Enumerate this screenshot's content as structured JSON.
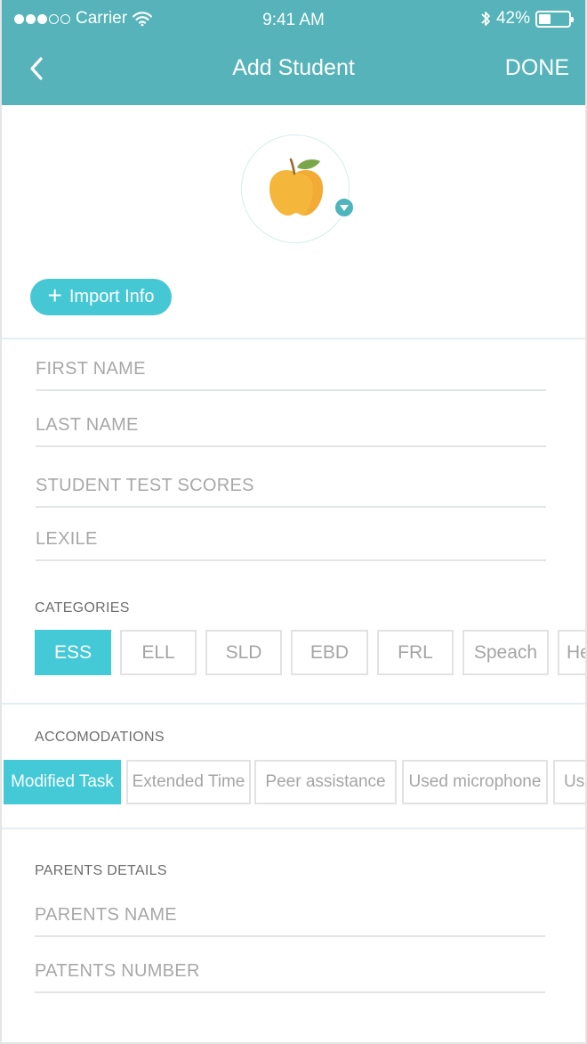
{
  "status_bar": {
    "carrier": "Carrier",
    "time": "9:41 AM",
    "battery": "42%",
    "battery_level": 0.42
  },
  "nav": {
    "back_icon": "chevron-left-icon",
    "title": "Add Student",
    "done_label": "DONE"
  },
  "avatar": {
    "icon": "apple-icon",
    "dropdown_icon": "caret-down-icon"
  },
  "import_button": {
    "icon": "plus-icon",
    "label": "Import Info"
  },
  "fields": {
    "first_name": {
      "placeholder": "FIRST NAME",
      "value": ""
    },
    "last_name": {
      "placeholder": "LAST NAME",
      "value": ""
    },
    "test_scores": {
      "placeholder": "STUDENT TEST SCORES",
      "value": ""
    },
    "lexile": {
      "placeholder": "LEXILE",
      "value": ""
    }
  },
  "categories": {
    "label": "CATEGORIES",
    "items": [
      "ESS",
      "ELL",
      "SLD",
      "EBD",
      "FRL",
      "Speach",
      "He"
    ],
    "selected": "ESS"
  },
  "accomodations": {
    "label": "ACCOMODATIONS",
    "items": [
      "Modified Task",
      "Extended Time",
      "Peer assistance",
      "Used microphone",
      "Us"
    ],
    "selected": "Modified Task"
  },
  "parents": {
    "label": "PARENTS DETAILS",
    "name": {
      "placeholder": "PARENTS NAME",
      "value": ""
    },
    "number": {
      "placeholder": "PATENTS NUMBER",
      "value": ""
    }
  },
  "colors": {
    "header": "#55b3b9",
    "accent": "#44c9d6",
    "apple_body": "#f5b63c",
    "apple_leaf": "#7aa64a"
  }
}
